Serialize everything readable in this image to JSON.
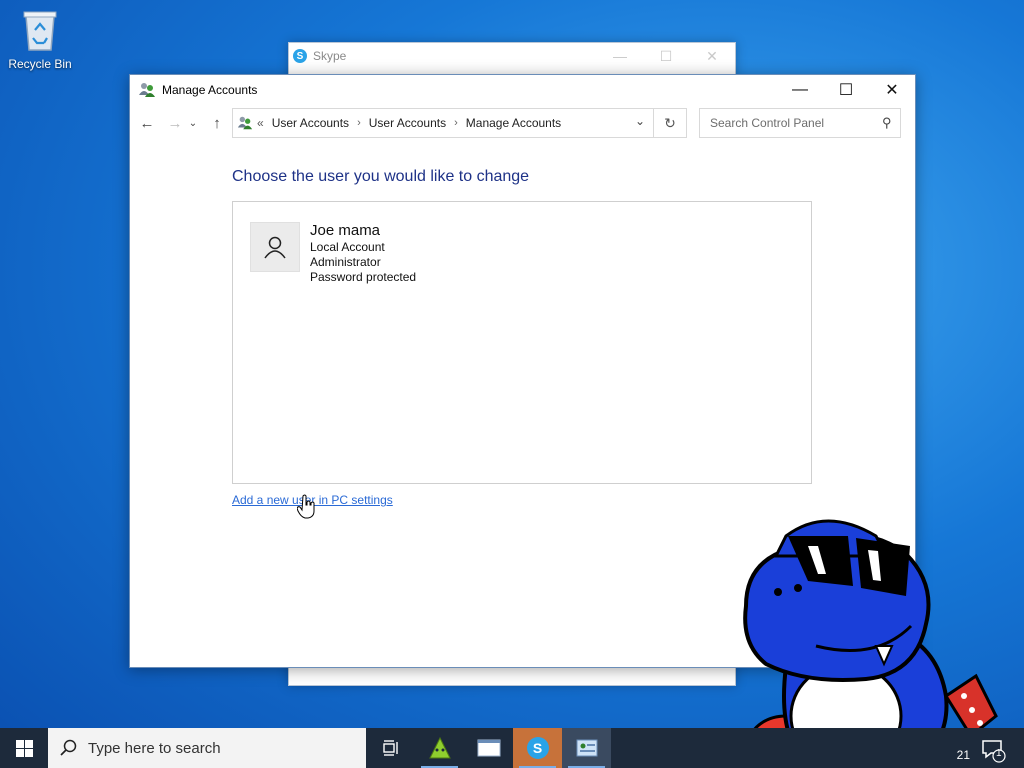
{
  "desktop": {
    "recycle_bin_label": "Recycle Bin"
  },
  "background_window": {
    "title": "Skype",
    "minimize": "—",
    "maximize": "☐",
    "close": "✕"
  },
  "window": {
    "title": "Manage Accounts",
    "controls": {
      "minimize": "—",
      "maximize": "☐",
      "close": "✕"
    },
    "nav": {
      "back": "←",
      "forward": "→",
      "recent": "⌄",
      "up": "↑"
    },
    "breadcrumb": {
      "overflow": "«",
      "items": [
        "User Accounts",
        "User Accounts",
        "Manage Accounts"
      ],
      "separator": "›"
    },
    "refresh": "↻",
    "search_placeholder": "Search Control Panel"
  },
  "content": {
    "heading": "Choose the user you would like to change",
    "user": {
      "name": "Joe mama",
      "type": "Local Account",
      "role": "Administrator",
      "status": "Password protected"
    },
    "add_user_link": "Add a new user in PC settings"
  },
  "taskbar": {
    "search_placeholder": "Type here to search",
    "clock_fragment": "21",
    "notification_count": "1"
  },
  "colors": {
    "heading": "#1e3287",
    "link": "#2a6ad6",
    "taskbar": "#1d2a3b",
    "desktop": "#1677d6"
  }
}
